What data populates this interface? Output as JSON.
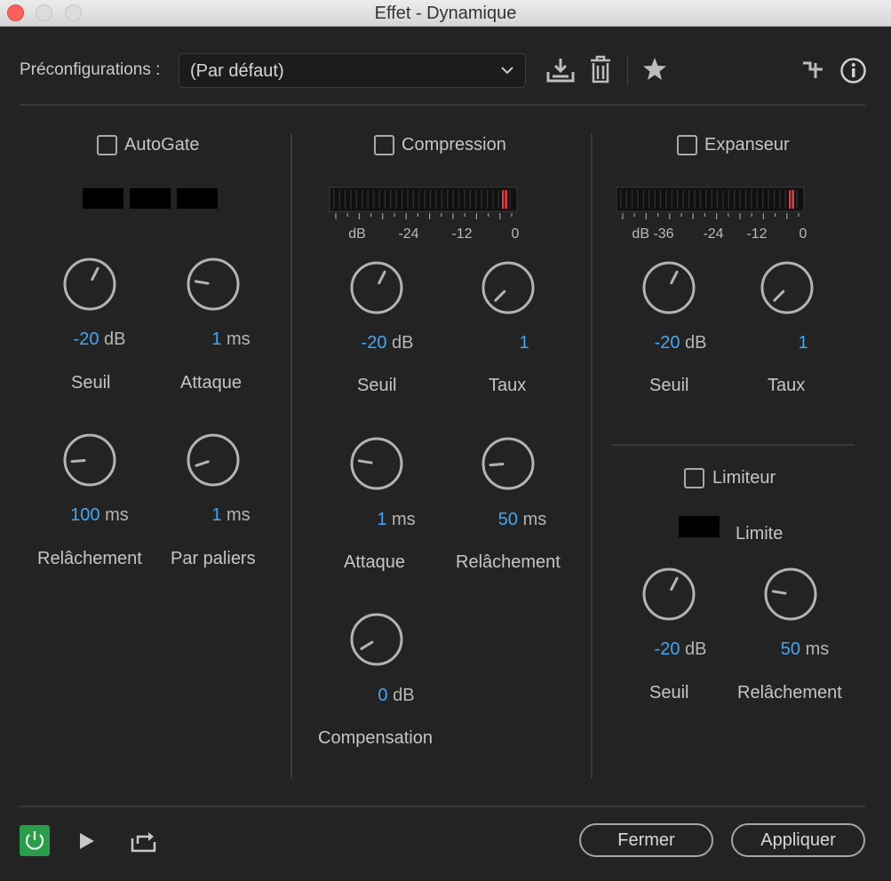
{
  "window": {
    "title": "Effet - Dynamique"
  },
  "presets": {
    "label": "Préconfigurations :",
    "selected": "(Par défaut)"
  },
  "toolbar_icons": [
    "save-preset-icon",
    "delete-icon",
    "favorite-star-icon",
    "routing-icon",
    "info-icon"
  ],
  "autogate": {
    "name": "AutoGate",
    "knobs": [
      {
        "value": "-20",
        "unit": "dB",
        "label": "Seuil",
        "level": 0.6
      },
      {
        "value": "1",
        "unit": "ms",
        "label": "Attaque",
        "level": 0.2
      },
      {
        "value": "100",
        "unit": "ms",
        "label": "Relâchement",
        "level": 0.15
      },
      {
        "value": "1",
        "unit": "ms",
        "label": "Par paliers",
        "level": 0.1
      }
    ]
  },
  "compression": {
    "name": "Compression",
    "meter": {
      "ticks": [
        "dB",
        "-24",
        "-12",
        "0"
      ]
    },
    "knobs": [
      {
        "value": "-20",
        "unit": "dB",
        "label": "Seuil",
        "level": 0.6
      },
      {
        "value": "1",
        "unit": "",
        "label": "Taux",
        "level": 0.0
      },
      {
        "value": "1",
        "unit": "ms",
        "label": "Attaque",
        "level": 0.2
      },
      {
        "value": "50",
        "unit": "ms",
        "label": "Relâchement",
        "level": 0.15
      },
      {
        "value": "0",
        "unit": "dB",
        "label": "Compensation",
        "level": 0.05
      }
    ]
  },
  "expanseur": {
    "name": "Expanseur",
    "meter": {
      "ticks": [
        "dB -36",
        "-24",
        "-12",
        "0"
      ]
    },
    "knobs": [
      {
        "value": "-20",
        "unit": "dB",
        "label": "Seuil",
        "level": 0.6
      },
      {
        "value": "1",
        "unit": "",
        "label": "Taux",
        "level": 0.0
      }
    ]
  },
  "limiteur": {
    "name": "Limiteur",
    "limit_label": "Limite",
    "knobs": [
      {
        "value": "-20",
        "unit": "dB",
        "label": "Seuil",
        "level": 0.6
      },
      {
        "value": "50",
        "unit": "ms",
        "label": "Relâchement",
        "level": 0.2
      }
    ]
  },
  "footer": {
    "close_label": "Fermer",
    "apply_label": "Appliquer"
  },
  "colors": {
    "accent_value": "#45a5f2",
    "power_on": "#2a9d4a",
    "meter_peak": "#e0393f"
  }
}
